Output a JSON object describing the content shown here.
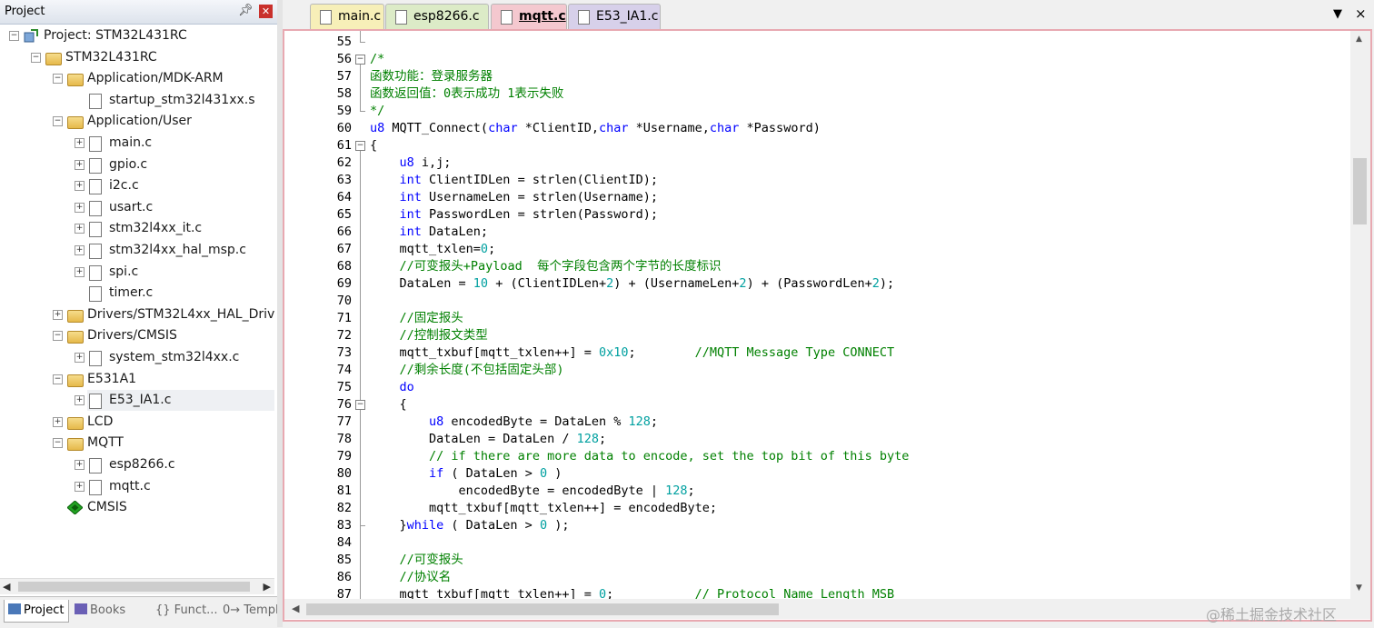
{
  "project_pane": {
    "title": "Project",
    "pin_icon": "pin-icon",
    "close_icon": "close-icon",
    "tree": [
      {
        "label": "Project: STM32L431RC",
        "depth": 0,
        "expander": "−",
        "kind": "project"
      },
      {
        "label": "STM32L431RC",
        "depth": 1,
        "expander": "−",
        "kind": "target"
      },
      {
        "label": "Application/MDK-ARM",
        "depth": 2,
        "expander": "−",
        "kind": "folder"
      },
      {
        "label": "startup_stm32l431xx.s",
        "depth": 3,
        "expander": "",
        "kind": "file"
      },
      {
        "label": "Application/User",
        "depth": 2,
        "expander": "−",
        "kind": "folder"
      },
      {
        "label": "main.c",
        "depth": 3,
        "expander": "+",
        "kind": "file"
      },
      {
        "label": "gpio.c",
        "depth": 3,
        "expander": "+",
        "kind": "file"
      },
      {
        "label": "i2c.c",
        "depth": 3,
        "expander": "+",
        "kind": "file"
      },
      {
        "label": "usart.c",
        "depth": 3,
        "expander": "+",
        "kind": "file"
      },
      {
        "label": "stm32l4xx_it.c",
        "depth": 3,
        "expander": "+",
        "kind": "file"
      },
      {
        "label": "stm32l4xx_hal_msp.c",
        "depth": 3,
        "expander": "+",
        "kind": "file"
      },
      {
        "label": "spi.c",
        "depth": 3,
        "expander": "+",
        "kind": "file"
      },
      {
        "label": "timer.c",
        "depth": 3,
        "expander": "",
        "kind": "file"
      },
      {
        "label": "Drivers/STM32L4xx_HAL_Driver",
        "depth": 2,
        "expander": "+",
        "kind": "folder"
      },
      {
        "label": "Drivers/CMSIS",
        "depth": 2,
        "expander": "−",
        "kind": "folder"
      },
      {
        "label": "system_stm32l4xx.c",
        "depth": 3,
        "expander": "+",
        "kind": "file"
      },
      {
        "label": "E531A1",
        "depth": 2,
        "expander": "−",
        "kind": "folder"
      },
      {
        "label": "E53_IA1.c",
        "depth": 3,
        "expander": "+",
        "kind": "file",
        "selected": true
      },
      {
        "label": "LCD",
        "depth": 2,
        "expander": "+",
        "kind": "folder"
      },
      {
        "label": "MQTT",
        "depth": 2,
        "expander": "−",
        "kind": "folder"
      },
      {
        "label": "esp8266.c",
        "depth": 3,
        "expander": "+",
        "kind": "file"
      },
      {
        "label": "mqtt.c",
        "depth": 3,
        "expander": "+",
        "kind": "file"
      },
      {
        "label": "CMSIS",
        "depth": 2,
        "expander": "",
        "kind": "component"
      }
    ],
    "tabs": [
      {
        "label": "Project",
        "active": true,
        "icon": "project-icon"
      },
      {
        "label": "Books",
        "active": false,
        "icon": "books-icon"
      },
      {
        "label": "{} Funct...",
        "active": false,
        "icon": "functions-icon"
      },
      {
        "label": "0→ Templ...",
        "active": false,
        "icon": "templates-icon"
      }
    ]
  },
  "editor": {
    "tabs": [
      {
        "id": "tab-main",
        "label": "main.c"
      },
      {
        "id": "tab-esp",
        "label": "esp8266.c"
      },
      {
        "id": "tab-mqtt",
        "label": "mqtt.c",
        "active": true
      },
      {
        "id": "tab-e53",
        "label": "E53_IA1.c"
      }
    ],
    "dropdown_icon": "▼",
    "close_icon": "×",
    "lines": [
      {
        "n": "55",
        "seg": [
          {
            "t": ""
          }
        ]
      },
      {
        "n": "56",
        "seg": [
          {
            "t": "/*",
            "c": "cm"
          }
        ]
      },
      {
        "n": "57",
        "seg": [
          {
            "t": "函数功能：登录服务器",
            "c": "cm"
          }
        ]
      },
      {
        "n": "58",
        "seg": [
          {
            "t": "函数返回值：0表示成功 1表示失败",
            "c": "cm"
          }
        ]
      },
      {
        "n": "59",
        "seg": [
          {
            "t": "*/",
            "c": "cm"
          }
        ]
      },
      {
        "n": "60",
        "seg": [
          {
            "t": "u8",
            "c": "kw"
          },
          {
            "t": " MQTT_Connect("
          },
          {
            "t": "char",
            "c": "kw"
          },
          {
            "t": " *ClientID,"
          },
          {
            "t": "char",
            "c": "kw"
          },
          {
            "t": " *Username,"
          },
          {
            "t": "char",
            "c": "kw"
          },
          {
            "t": " *Password)"
          }
        ]
      },
      {
        "n": "61",
        "seg": [
          {
            "t": "{"
          }
        ]
      },
      {
        "n": "62",
        "seg": [
          {
            "t": "    "
          },
          {
            "t": "u8",
            "c": "kw"
          },
          {
            "t": " i,j;"
          }
        ]
      },
      {
        "n": "63",
        "seg": [
          {
            "t": "    "
          },
          {
            "t": "int",
            "c": "kw"
          },
          {
            "t": " ClientIDLen = strlen(ClientID);"
          }
        ]
      },
      {
        "n": "64",
        "seg": [
          {
            "t": "    "
          },
          {
            "t": "int",
            "c": "kw"
          },
          {
            "t": " UsernameLen = strlen(Username);"
          }
        ]
      },
      {
        "n": "65",
        "seg": [
          {
            "t": "    "
          },
          {
            "t": "int",
            "c": "kw"
          },
          {
            "t": " PasswordLen = strlen(Password);"
          }
        ]
      },
      {
        "n": "66",
        "seg": [
          {
            "t": "    "
          },
          {
            "t": "int",
            "c": "kw"
          },
          {
            "t": " DataLen;"
          }
        ]
      },
      {
        "n": "67",
        "seg": [
          {
            "t": "    mqtt_txlen="
          },
          {
            "t": "0",
            "c": "nm"
          },
          {
            "t": ";"
          }
        ]
      },
      {
        "n": "68",
        "seg": [
          {
            "t": "    "
          },
          {
            "t": "//可变报头+Payload  每个字段包含两个字节的长度标识",
            "c": "cm"
          }
        ]
      },
      {
        "n": "69",
        "seg": [
          {
            "t": "    DataLen = "
          },
          {
            "t": "10",
            "c": "nm"
          },
          {
            "t": " + (ClientIDLen+"
          },
          {
            "t": "2",
            "c": "nm"
          },
          {
            "t": ") + (UsernameLen+"
          },
          {
            "t": "2",
            "c": "nm"
          },
          {
            "t": ") + (PasswordLen+"
          },
          {
            "t": "2",
            "c": "nm"
          },
          {
            "t": ");"
          }
        ]
      },
      {
        "n": "70",
        "seg": [
          {
            "t": ""
          }
        ]
      },
      {
        "n": "71",
        "seg": [
          {
            "t": "    "
          },
          {
            "t": "//固定报头",
            "c": "cm"
          }
        ]
      },
      {
        "n": "72",
        "seg": [
          {
            "t": "    "
          },
          {
            "t": "//控制报文类型",
            "c": "cm"
          }
        ]
      },
      {
        "n": "73",
        "seg": [
          {
            "t": "    mqtt_txbuf[mqtt_txlen++] = "
          },
          {
            "t": "0x10",
            "c": "nm"
          },
          {
            "t": ";        "
          },
          {
            "t": "//MQTT Message Type CONNECT",
            "c": "cm"
          }
        ]
      },
      {
        "n": "74",
        "seg": [
          {
            "t": "    "
          },
          {
            "t": "//剩余长度(不包括固定头部)",
            "c": "cm"
          }
        ]
      },
      {
        "n": "75",
        "seg": [
          {
            "t": "    "
          },
          {
            "t": "do",
            "c": "kw"
          }
        ]
      },
      {
        "n": "76",
        "seg": [
          {
            "t": "    {"
          }
        ]
      },
      {
        "n": "77",
        "seg": [
          {
            "t": "        "
          },
          {
            "t": "u8",
            "c": "kw"
          },
          {
            "t": " encodedByte = DataLen % "
          },
          {
            "t": "128",
            "c": "nm"
          },
          {
            "t": ";"
          }
        ]
      },
      {
        "n": "78",
        "seg": [
          {
            "t": "        DataLen = DataLen / "
          },
          {
            "t": "128",
            "c": "nm"
          },
          {
            "t": ";"
          }
        ]
      },
      {
        "n": "79",
        "seg": [
          {
            "t": "        "
          },
          {
            "t": "// if there are more data to encode, set the top bit of this byte",
            "c": "cm"
          }
        ]
      },
      {
        "n": "80",
        "seg": [
          {
            "t": "        "
          },
          {
            "t": "if",
            "c": "kw"
          },
          {
            "t": " ( DataLen > "
          },
          {
            "t": "0",
            "c": "nm"
          },
          {
            "t": " )"
          }
        ]
      },
      {
        "n": "81",
        "seg": [
          {
            "t": "            encodedByte = encodedByte | "
          },
          {
            "t": "128",
            "c": "nm"
          },
          {
            "t": ";"
          }
        ]
      },
      {
        "n": "82",
        "seg": [
          {
            "t": "        mqtt_txbuf[mqtt_txlen++] = encodedByte;"
          }
        ]
      },
      {
        "n": "83",
        "seg": [
          {
            "t": "    }"
          },
          {
            "t": "while",
            "c": "kw"
          },
          {
            "t": " ( DataLen > "
          },
          {
            "t": "0",
            "c": "nm"
          },
          {
            "t": " );"
          }
        ]
      },
      {
        "n": "84",
        "seg": [
          {
            "t": ""
          }
        ]
      },
      {
        "n": "85",
        "seg": [
          {
            "t": "    "
          },
          {
            "t": "//可变报头",
            "c": "cm"
          }
        ]
      },
      {
        "n": "86",
        "seg": [
          {
            "t": "    "
          },
          {
            "t": "//协议名",
            "c": "cm"
          }
        ]
      },
      {
        "n": "87",
        "seg": [
          {
            "t": "    mqtt_txbuf[mqtt_txlen++] = "
          },
          {
            "t": "0",
            "c": "nm"
          },
          {
            "t": ";           "
          },
          {
            "t": "// Protocol Name Length MSB",
            "c": "cm"
          }
        ]
      }
    ],
    "watermark": "@稀土掘金技术社区"
  }
}
